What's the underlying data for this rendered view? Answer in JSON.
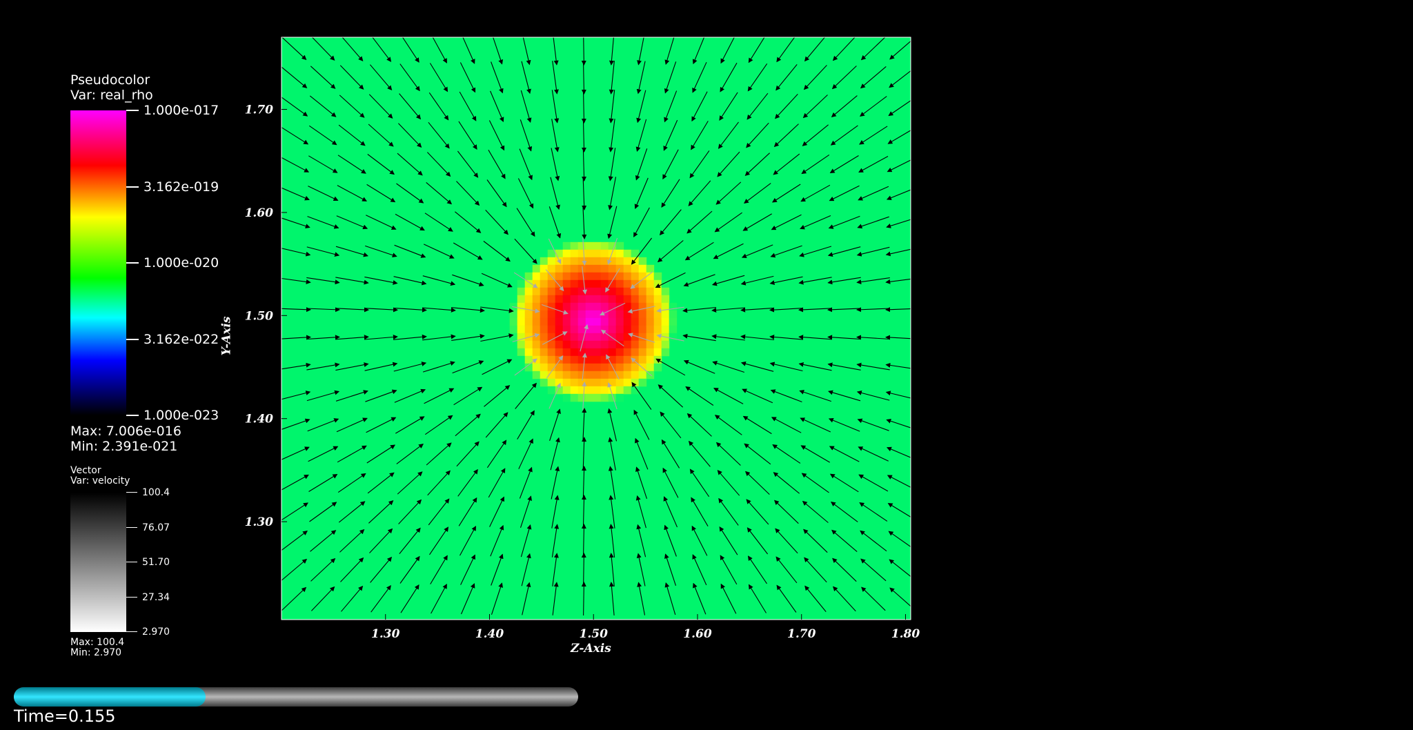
{
  "pseudocolor_legend": {
    "title": "Pseudocolor",
    "var": "Var: real_rho",
    "ticks": [
      "1.000e-017",
      "3.162e-019",
      "1.000e-020",
      "3.162e-022",
      "1.000e-023"
    ],
    "max": "Max:  7.006e-016",
    "min": "Min:  2.391e-021"
  },
  "vector_legend": {
    "title": "Vector",
    "var": "Var: velocity",
    "ticks": [
      "100.4",
      "76.07",
      "51.70",
      "27.34",
      "2.970"
    ],
    "max": "Max:  100.4",
    "min": "Min:  2.970"
  },
  "time": {
    "label": "Time=0.155",
    "progress": 0.34
  },
  "colors": {
    "field": "#00f56c",
    "arrow": "#000000"
  },
  "chart_data": {
    "type": "heatmap",
    "xlabel": "Z-Axis",
    "ylabel": "Y-Axis",
    "xlim": [
      1.2,
      1.805
    ],
    "ylim": [
      1.205,
      1.77
    ],
    "x_ticks": [
      "1.30",
      "1.40",
      "1.50",
      "1.60",
      "1.70",
      "1.80"
    ],
    "y_ticks": [
      "1.30",
      "1.40",
      "1.50",
      "1.60",
      "1.70"
    ],
    "x_tick_values": [
      1.3,
      1.4,
      1.5,
      1.6,
      1.7,
      1.8
    ],
    "y_tick_values": [
      1.3,
      1.4,
      1.5,
      1.6,
      1.7
    ],
    "blob_center": [
      1.495,
      1.495
    ],
    "blob_radius": 0.075,
    "colorbar_scale": "log",
    "vector_field": "radial inflow toward center"
  }
}
